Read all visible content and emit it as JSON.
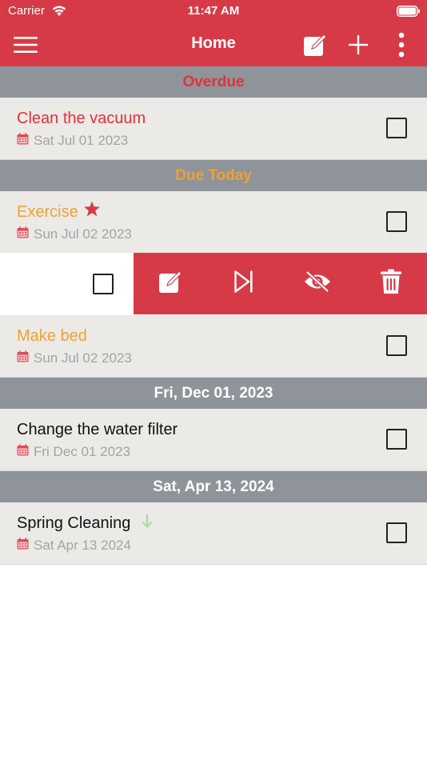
{
  "status_bar": {
    "carrier": "Carrier",
    "time": "11:47 AM"
  },
  "nav": {
    "title": "Home"
  },
  "colors": {
    "brand": "#d63a46",
    "overdue": "#e5303a",
    "today": "#f0a132",
    "section_bg": "#8f949b",
    "row_bg": "#ebeae7"
  },
  "sections": {
    "overdue": {
      "label": "Overdue"
    },
    "due_today": {
      "label": "Due Today"
    },
    "dec": {
      "label": "Fri, Dec 01, 2023"
    },
    "apr": {
      "label": "Sat, Apr 13, 2024"
    }
  },
  "tasks": {
    "clean_vacuum": {
      "title": "Clean the vacuum",
      "date": "Sat Jul 01 2023"
    },
    "exercise": {
      "title": "Exercise",
      "date": "Sun Jul 02 2023"
    },
    "make_bed": {
      "title": "Make bed",
      "date": "Sun Jul 02 2023"
    },
    "water_filter": {
      "title": "Change the water filter",
      "date": "Fri Dec 01 2023"
    },
    "spring_cleaning": {
      "title": "Spring Cleaning",
      "date": "Sat Apr 13 2024"
    }
  },
  "icons": {
    "menu": "hamburger-menu-icon",
    "edit": "edit-icon",
    "add": "plus-icon",
    "more": "more-vertical-icon",
    "calendar": "calendar-icon",
    "star": "star-icon",
    "low_priority": "arrow-down-icon",
    "skip": "skip-next-icon",
    "hide": "eye-slash-icon",
    "delete": "trash-icon"
  }
}
